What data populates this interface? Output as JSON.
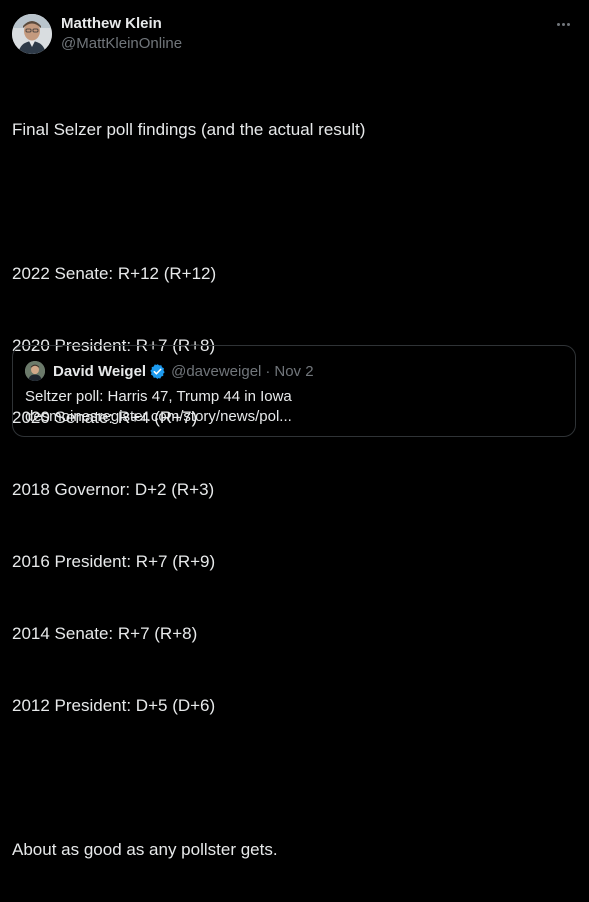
{
  "author": {
    "display_name": "Matthew Klein",
    "handle": "@MattKleinOnline",
    "avatar": "profile-photo"
  },
  "more_icon": "more-horizontal-icon",
  "tweet": {
    "lines": [
      "Final Selzer poll findings (and the actual result)",
      "",
      "2022 Senate: R+12 (R+12)",
      "2020 President: R+7 (R+8)",
      "2020 Senate: R+4 (R+7)",
      "2018 Governor: D+2 (R+3)",
      "2016 President: R+7 (R+9)",
      "2014 Senate: R+7 (R+8)",
      "2012 President: D+5 (D+6)",
      "",
      "About as good as any pollster gets."
    ]
  },
  "quoted": {
    "display_name": "David Weigel",
    "verified_icon": "verified-badge-icon",
    "handle": "@daveweigel",
    "separator": "·",
    "date": "Nov 2",
    "text": "Seltzer poll: Harris 47, Trump 44 in Iowa",
    "link": "desmoinesregister.com/story/news/pol..."
  },
  "colors": {
    "background": "#000000",
    "primary_text": "#e7e9ea",
    "secondary_text": "#71767b",
    "border": "#2f3336",
    "verified": "#1d9bf0"
  }
}
